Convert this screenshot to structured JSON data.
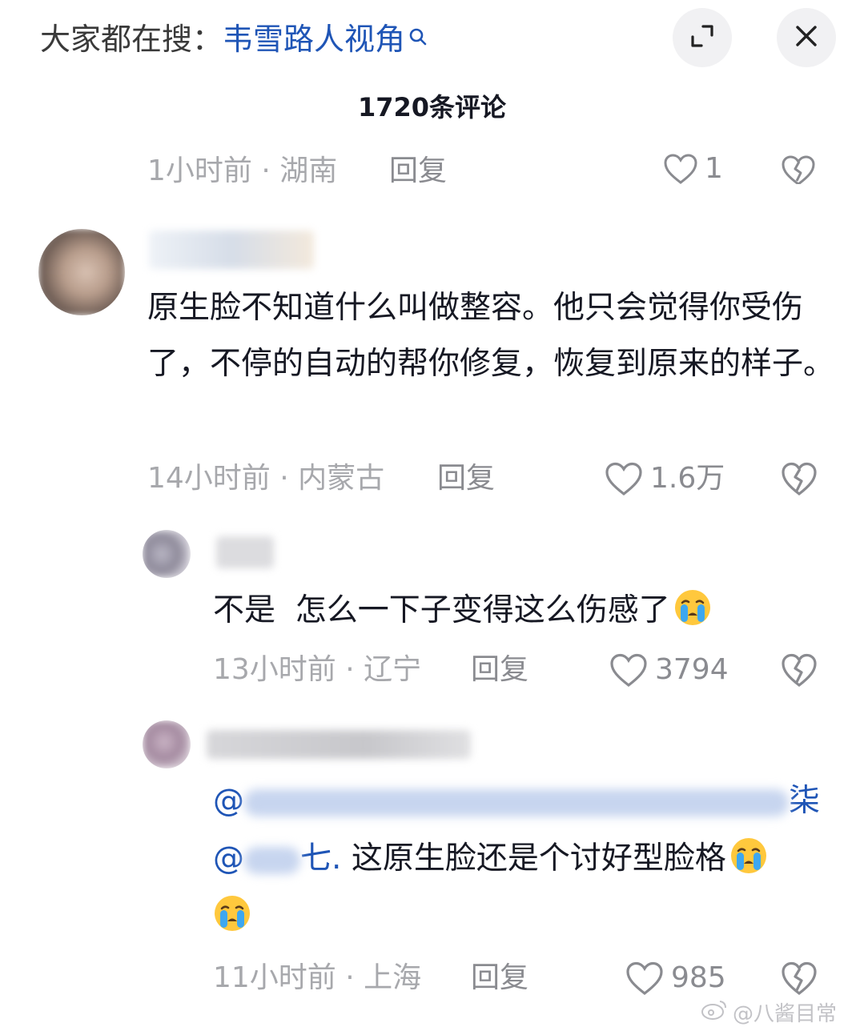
{
  "header": {
    "search_prefix": "大家都在搜：",
    "search_term": "韦雪路人视角",
    "search_icon": "search-icon",
    "expand_icon": "expand-icon",
    "close_icon": "close-icon"
  },
  "comment_count": "1720条评论",
  "previous_comment": {
    "time": "1小时前",
    "location": "湖南",
    "reply_label": "回复",
    "likes": "1"
  },
  "comments": [
    {
      "text": "原生脸不知道什么叫做整容。他只会觉得你受伤了，不停的自动的帮你修复，恢复到原来的样子。",
      "time": "14小时前",
      "location": "内蒙古",
      "reply_label": "回复",
      "likes": "1.6万"
    },
    {
      "text": "不是  怎么一下子变得这么伤感了",
      "time": "13小时前",
      "location": "辽宁",
      "reply_label": "回复",
      "likes": "3794",
      "emoji": "crying-face"
    },
    {
      "mention_line1_start": "@",
      "mention_line1_end": "柒",
      "mention_line2_start": "@",
      "mention_line2_end": "七.",
      "text": "这原生脸还是个讨好型脸格",
      "time": "11小时前",
      "location": "上海",
      "reply_label": "回复",
      "likes": "985",
      "emoji": "crying-face"
    }
  ],
  "separator": "·",
  "watermark": "@八酱目常",
  "colors": {
    "link_blue": "#1f55b6",
    "meta_gray": "#a7a8ac",
    "text_dark": "#161823",
    "button_bg": "#f1f1f3"
  }
}
